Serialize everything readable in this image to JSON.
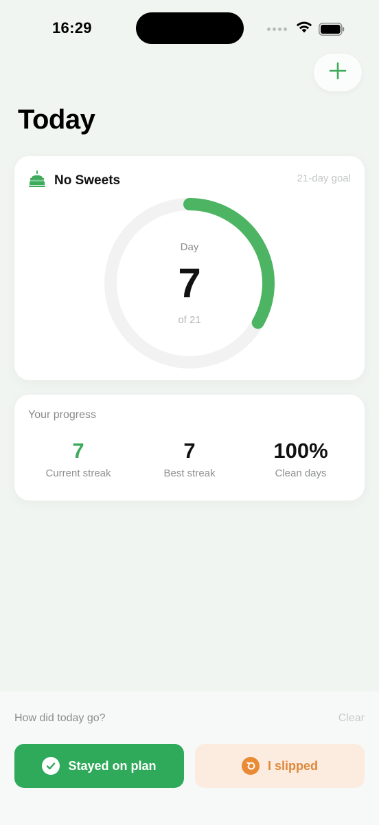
{
  "status_bar": {
    "time": "16:29"
  },
  "header": {
    "title": "Today",
    "add_icon": "plus-icon"
  },
  "habit_card": {
    "icon": "cake-icon",
    "name": "No Sweets",
    "goal_label": "21-day goal",
    "ring": {
      "day_label": "Day",
      "current_day": "7",
      "of_label": "of 21",
      "progress_fraction": 0.333
    }
  },
  "progress_card": {
    "title": "Your progress",
    "stats": [
      {
        "value": "7",
        "label": "Current streak"
      },
      {
        "value": "7",
        "label": "Best streak"
      },
      {
        "value": "100%",
        "label": "Clean days"
      }
    ]
  },
  "checkin": {
    "prompt": "How did today go?",
    "clear_label": "Clear",
    "stayed_label": "Stayed on plan",
    "slipped_label": "I slipped"
  },
  "colors": {
    "accent_green": "#3dab5c",
    "button_green": "#2fa95a",
    "slip_orange": "#e98a35",
    "slip_bg": "#fbecdf"
  }
}
